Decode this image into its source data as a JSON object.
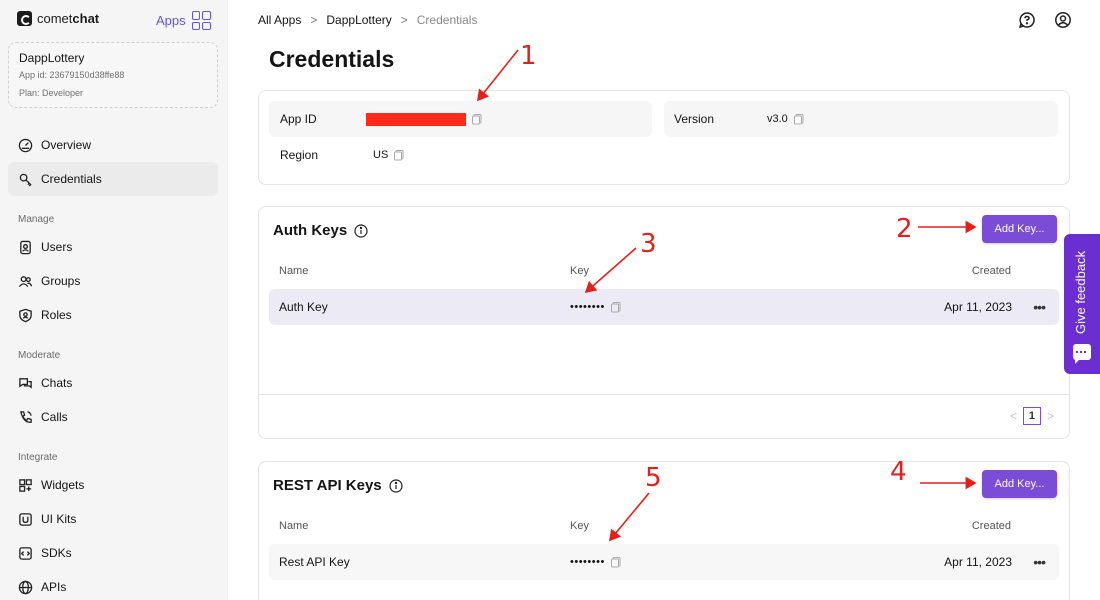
{
  "brand": {
    "name_light": "comet",
    "name_bold": "chat"
  },
  "apps_link": "Apps",
  "app_card": {
    "name": "DappLottery",
    "app_id_line": "App id: 23679150d38ffe88",
    "plan_line": "Plan: Developer"
  },
  "nav": {
    "overview": "Overview",
    "credentials": "Credentials",
    "manage": "Manage",
    "users": "Users",
    "groups": "Groups",
    "roles": "Roles",
    "moderate": "Moderate",
    "chats": "Chats",
    "calls": "Calls",
    "integrate": "Integrate",
    "widgets": "Widgets",
    "ui_kits": "UI Kits",
    "sdks": "SDKs",
    "apis": "APIs"
  },
  "breadcrumb": [
    "All Apps",
    ">",
    "DappLottery",
    ">",
    "Credentials"
  ],
  "page_title": "Credentials",
  "credentials": {
    "app_id_label": "App ID",
    "version_label": "Version",
    "version_value": "v3.0",
    "region_label": "Region",
    "region_value": "US"
  },
  "auth_keys": {
    "title": "Auth Keys",
    "add_button": "Add Key...",
    "columns": {
      "name": "Name",
      "key": "Key",
      "created": "Created"
    },
    "row": {
      "name": "Auth Key",
      "key": "••••••••",
      "created": "Apr 11, 2023",
      "more": "•••"
    },
    "pagination": {
      "prev": "<",
      "page": "1",
      "next": ">"
    }
  },
  "rest_keys": {
    "title": "REST API Keys",
    "add_button": "Add Key...",
    "columns": {
      "name": "Name",
      "key": "Key",
      "created": "Created"
    },
    "row": {
      "name": "Rest API Key",
      "key": "••••••••",
      "created": "Apr 11, 2023",
      "more": "•••"
    }
  },
  "feedback": "Give feedback",
  "annotations": [
    "1",
    "2",
    "3",
    "4",
    "5"
  ],
  "colors": {
    "accent": "#7b4cd6",
    "feedback": "#6b2fd1",
    "annotation": "#e3211a",
    "redaction": "#ff2a1a"
  }
}
